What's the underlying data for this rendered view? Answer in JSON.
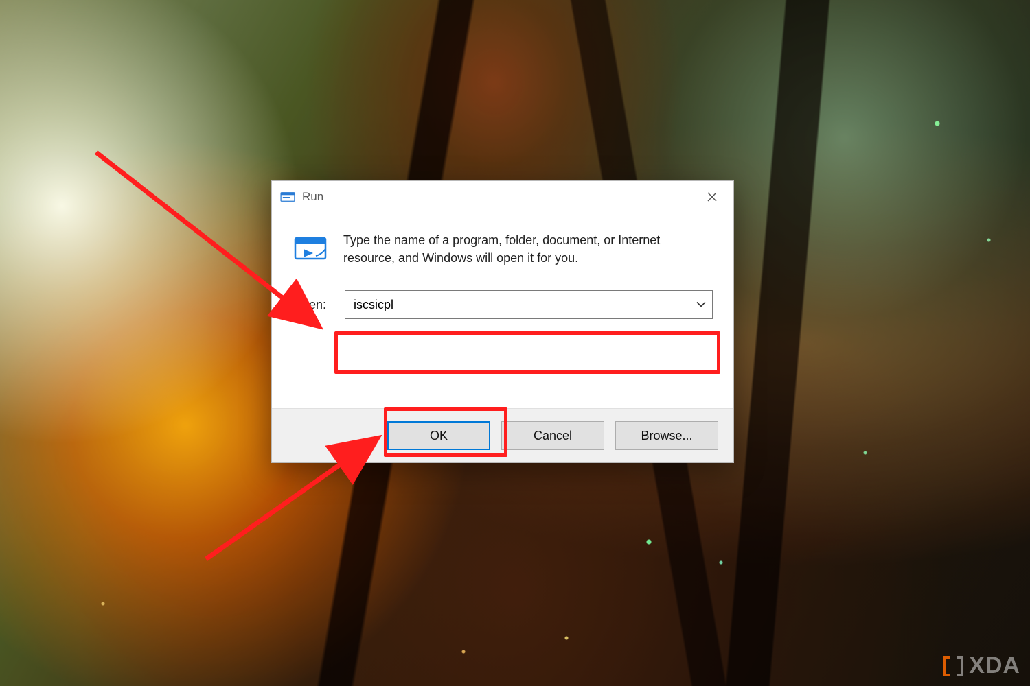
{
  "dialog": {
    "title": "Run",
    "description": "Type the name of a program, folder, document, or Internet resource, and Windows will open it for you.",
    "open_label": "Open:",
    "open_value": "iscsicpl",
    "buttons": {
      "ok": "OK",
      "cancel": "Cancel",
      "browse": "Browse..."
    }
  },
  "annotations": {
    "highlight_open_input": true,
    "highlight_ok_button": true,
    "color": "#ff1e1e"
  },
  "watermark": {
    "text": "XDA"
  }
}
